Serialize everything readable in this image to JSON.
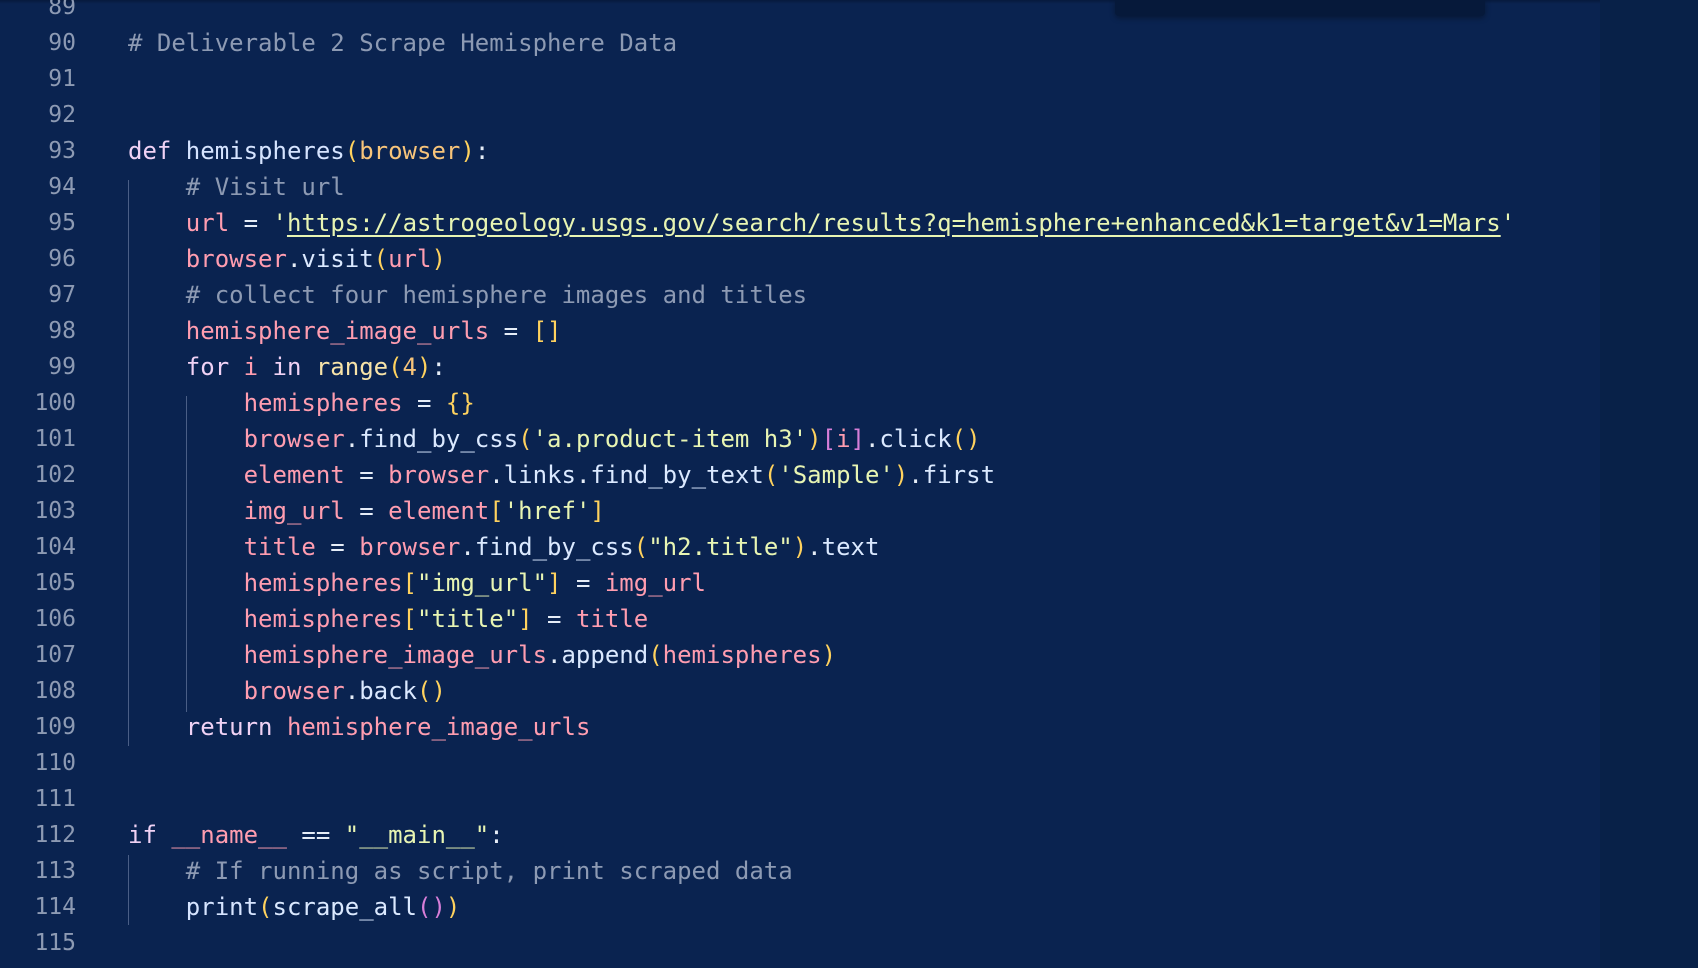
{
  "editor": {
    "lines": [
      {
        "n": "89",
        "tokens": []
      },
      {
        "n": "90",
        "tokens": [
          {
            "t": "# Deliverable 2 Scrape Hemisphere Data",
            "c": "comment"
          }
        ]
      },
      {
        "n": "91",
        "tokens": []
      },
      {
        "n": "92",
        "tokens": []
      },
      {
        "n": "93",
        "tokens": [
          {
            "t": "def ",
            "c": "keyword"
          },
          {
            "t": "hemispheres",
            "c": "func"
          },
          {
            "t": "(",
            "c": "bracket"
          },
          {
            "t": "browser",
            "c": "param"
          },
          {
            "t": ")",
            "c": "bracket"
          },
          {
            "t": ":",
            "c": "plain"
          }
        ]
      },
      {
        "n": "94",
        "tokens": [
          {
            "t": "    # Visit url",
            "c": "comment"
          }
        ]
      },
      {
        "n": "95",
        "tokens": [
          {
            "t": "    url",
            "c": "var"
          },
          {
            "t": " = ",
            "c": "plain"
          },
          {
            "t": "'",
            "c": "string"
          },
          {
            "t": "https://astrogeology.usgs.gov/search/results?q=hemisphere+enhanced&k1=target&v1=Mars",
            "c": "url"
          },
          {
            "t": "'",
            "c": "string"
          }
        ]
      },
      {
        "n": "96",
        "tokens": [
          {
            "t": "    browser",
            "c": "var"
          },
          {
            "t": ".",
            "c": "plain"
          },
          {
            "t": "visit",
            "c": "method"
          },
          {
            "t": "(",
            "c": "bracket"
          },
          {
            "t": "url",
            "c": "var"
          },
          {
            "t": ")",
            "c": "bracket"
          }
        ]
      },
      {
        "n": "97",
        "tokens": [
          {
            "t": "    # collect four hemisphere images and titles",
            "c": "comment"
          }
        ]
      },
      {
        "n": "98",
        "tokens": [
          {
            "t": "    hemisphere_image_urls",
            "c": "var"
          },
          {
            "t": " = ",
            "c": "plain"
          },
          {
            "t": "[]",
            "c": "bracket"
          }
        ]
      },
      {
        "n": "99",
        "tokens": [
          {
            "t": "    for ",
            "c": "keyword"
          },
          {
            "t": "i",
            "c": "var"
          },
          {
            "t": " in ",
            "c": "keyword"
          },
          {
            "t": "range",
            "c": "builtin"
          },
          {
            "t": "(",
            "c": "bracket"
          },
          {
            "t": "4",
            "c": "number"
          },
          {
            "t": ")",
            "c": "bracket"
          },
          {
            "t": ":",
            "c": "plain"
          }
        ]
      },
      {
        "n": "100",
        "tokens": [
          {
            "t": "        hemispheres",
            "c": "var"
          },
          {
            "t": " = ",
            "c": "plain"
          },
          {
            "t": "{}",
            "c": "bracket"
          }
        ]
      },
      {
        "n": "101",
        "tokens": [
          {
            "t": "        browser",
            "c": "var"
          },
          {
            "t": ".",
            "c": "plain"
          },
          {
            "t": "find_by_css",
            "c": "method"
          },
          {
            "t": "(",
            "c": "bracket"
          },
          {
            "t": "'a.product-item h3'",
            "c": "string"
          },
          {
            "t": ")",
            "c": "bracket"
          },
          {
            "t": "[",
            "c": "bracket2"
          },
          {
            "t": "i",
            "c": "var"
          },
          {
            "t": "]",
            "c": "bracket2"
          },
          {
            "t": ".",
            "c": "plain"
          },
          {
            "t": "click",
            "c": "method"
          },
          {
            "t": "()",
            "c": "bracket"
          }
        ]
      },
      {
        "n": "102",
        "tokens": [
          {
            "t": "        element",
            "c": "var"
          },
          {
            "t": " = ",
            "c": "plain"
          },
          {
            "t": "browser",
            "c": "var"
          },
          {
            "t": ".",
            "c": "plain"
          },
          {
            "t": "links",
            "c": "method"
          },
          {
            "t": ".",
            "c": "plain"
          },
          {
            "t": "find_by_text",
            "c": "method"
          },
          {
            "t": "(",
            "c": "bracket"
          },
          {
            "t": "'Sample'",
            "c": "string"
          },
          {
            "t": ")",
            "c": "bracket"
          },
          {
            "t": ".",
            "c": "plain"
          },
          {
            "t": "first",
            "c": "method"
          }
        ]
      },
      {
        "n": "103",
        "tokens": [
          {
            "t": "        img_url",
            "c": "var"
          },
          {
            "t": " = ",
            "c": "plain"
          },
          {
            "t": "element",
            "c": "var"
          },
          {
            "t": "[",
            "c": "bracket"
          },
          {
            "t": "'href'",
            "c": "string"
          },
          {
            "t": "]",
            "c": "bracket"
          }
        ]
      },
      {
        "n": "104",
        "tokens": [
          {
            "t": "        title",
            "c": "var"
          },
          {
            "t": " = ",
            "c": "plain"
          },
          {
            "t": "browser",
            "c": "var"
          },
          {
            "t": ".",
            "c": "plain"
          },
          {
            "t": "find_by_css",
            "c": "method"
          },
          {
            "t": "(",
            "c": "bracket"
          },
          {
            "t": "\"h2.title\"",
            "c": "string"
          },
          {
            "t": ")",
            "c": "bracket"
          },
          {
            "t": ".",
            "c": "plain"
          },
          {
            "t": "text",
            "c": "method"
          }
        ]
      },
      {
        "n": "105",
        "tokens": [
          {
            "t": "        hemispheres",
            "c": "var"
          },
          {
            "t": "[",
            "c": "bracket"
          },
          {
            "t": "\"img_url\"",
            "c": "string"
          },
          {
            "t": "]",
            "c": "bracket"
          },
          {
            "t": " = ",
            "c": "plain"
          },
          {
            "t": "img_url",
            "c": "var"
          }
        ]
      },
      {
        "n": "106",
        "tokens": [
          {
            "t": "        hemispheres",
            "c": "var"
          },
          {
            "t": "[",
            "c": "bracket"
          },
          {
            "t": "\"title\"",
            "c": "string"
          },
          {
            "t": "]",
            "c": "bracket"
          },
          {
            "t": " = ",
            "c": "plain"
          },
          {
            "t": "title",
            "c": "var"
          }
        ]
      },
      {
        "n": "107",
        "tokens": [
          {
            "t": "        hemisphere_image_urls",
            "c": "var"
          },
          {
            "t": ".",
            "c": "plain"
          },
          {
            "t": "append",
            "c": "method"
          },
          {
            "t": "(",
            "c": "bracket"
          },
          {
            "t": "hemispheres",
            "c": "var"
          },
          {
            "t": ")",
            "c": "bracket"
          }
        ]
      },
      {
        "n": "108",
        "tokens": [
          {
            "t": "        browser",
            "c": "var"
          },
          {
            "t": ".",
            "c": "plain"
          },
          {
            "t": "back",
            "c": "method"
          },
          {
            "t": "()",
            "c": "bracket"
          }
        ]
      },
      {
        "n": "109",
        "tokens": [
          {
            "t": "    return ",
            "c": "keyword"
          },
          {
            "t": "hemisphere_image_urls",
            "c": "var"
          }
        ]
      },
      {
        "n": "110",
        "tokens": []
      },
      {
        "n": "111",
        "tokens": []
      },
      {
        "n": "112",
        "tokens": [
          {
            "t": "if ",
            "c": "keyword"
          },
          {
            "t": "__name__",
            "c": "dunder"
          },
          {
            "t": " == ",
            "c": "plain"
          },
          {
            "t": "\"__main__\"",
            "c": "string"
          },
          {
            "t": ":",
            "c": "plain"
          }
        ]
      },
      {
        "n": "113",
        "tokens": [
          {
            "t": "    # If running as script, print scraped data",
            "c": "comment"
          }
        ]
      },
      {
        "n": "114",
        "tokens": [
          {
            "t": "    print",
            "c": "func"
          },
          {
            "t": "(",
            "c": "bracket"
          },
          {
            "t": "scrape_all",
            "c": "method"
          },
          {
            "t": "()",
            "c": "bracket2"
          },
          {
            "t": ")",
            "c": "bracket"
          }
        ]
      },
      {
        "n": "115",
        "tokens": []
      }
    ]
  }
}
